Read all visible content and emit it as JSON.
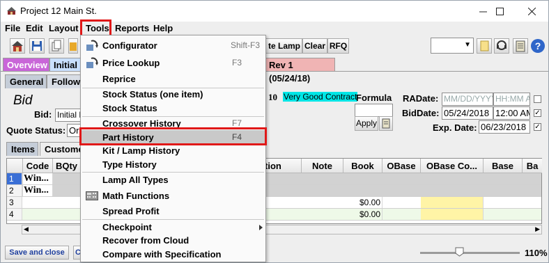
{
  "window": {
    "title": "Project 12 Main St."
  },
  "menubar": {
    "items": [
      "File",
      "Edit",
      "Layout",
      "Tools",
      "Reports",
      "Help"
    ]
  },
  "toolbar": {
    "buttons": [
      "te Lamp",
      "Clear",
      "RFQ"
    ]
  },
  "tabs_top": {
    "overview": "Overview",
    "initial": "Initial",
    "rev": "Rev 1 (05/24/18)"
  },
  "tabs_second": {
    "general": "General",
    "follow": "Follow"
  },
  "bid": {
    "heading": "Bid",
    "bid_label": "Bid:",
    "bid_value": "Initial B",
    "quote_status_label": "Quote Status:",
    "quote_status_value": "Or",
    "number_fragment": "10",
    "contract_badge": "Very Good Contract",
    "formula_label": "Formula",
    "apply_label": "Apply",
    "radate_label": "RADate:",
    "radate_placeholder": "MM/DD/YYYY",
    "radate_time_placeholder": "HH:MM A",
    "biddate_label": "BidDate:",
    "biddate_value": "05/24/2018",
    "biddate_time": "12:00 AM",
    "expdate_label": "Exp. Date:",
    "expdate_value": "06/23/2018"
  },
  "subtabs": {
    "items": "Items",
    "customer": "Custome"
  },
  "grid": {
    "columns_left": [
      "Code",
      "BQty"
    ],
    "columns_right": [
      "tion",
      "Note",
      "Book",
      "OBase",
      "OBase Co...",
      "Base",
      "Ba"
    ],
    "rows": [
      {
        "num": "1",
        "code": "Win...",
        "book": ""
      },
      {
        "num": "2",
        "code": "Win...",
        "book": ""
      },
      {
        "num": "3",
        "code": "",
        "book": "$0.00"
      },
      {
        "num": "4",
        "code": "",
        "book": "$0.00"
      }
    ]
  },
  "tools_menu": {
    "items": [
      {
        "label": "Configurator",
        "shortcut": "Shift-F3"
      },
      {
        "label": "Price Lookup",
        "shortcut": "F3"
      },
      {
        "label": "Reprice",
        "shortcut": ""
      },
      {
        "label": "Stock Status (one item)",
        "shortcut": ""
      },
      {
        "label": "Stock Status",
        "shortcut": ""
      },
      {
        "label": "Crossover History",
        "shortcut": "F7"
      },
      {
        "label": "Part History",
        "shortcut": "F4"
      },
      {
        "label": "Kit / Lamp History",
        "shortcut": ""
      },
      {
        "label": "Type History",
        "shortcut": ""
      },
      {
        "label": "Lamp All Types",
        "shortcut": ""
      },
      {
        "label": "Math Functions",
        "shortcut": ""
      },
      {
        "label": "Spread Profit",
        "shortcut": ""
      },
      {
        "label": "Checkpoint",
        "shortcut": ""
      },
      {
        "label": "Recover from Cloud",
        "shortcut": ""
      },
      {
        "label": "Compare with Specification",
        "shortcut": ""
      }
    ]
  },
  "statusbar": {
    "save_close": "Save and close",
    "c_fragment": "C",
    "zoom": "110%"
  },
  "colors": {
    "highlight_box": "#e01818",
    "overview_tab": "#c966d8",
    "initial_tab": "#c9e0ff",
    "rev_tab": "#f0b4b4",
    "contract_badge": "#00e5e5",
    "grid_yellow": "#fff4a6"
  }
}
